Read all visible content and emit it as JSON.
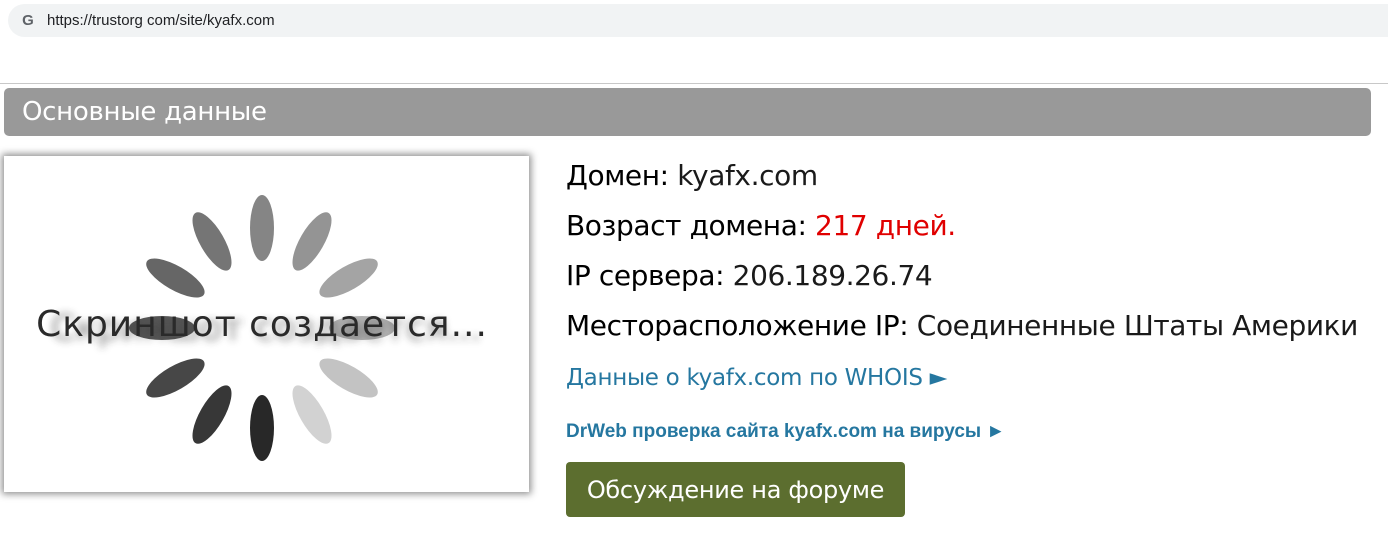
{
  "browser": {
    "url": "https://trustorg com/site/kyafx.com",
    "favicon": "google-g-icon"
  },
  "section": {
    "title": "Основные данные"
  },
  "screenshot": {
    "placeholder_text": "Скриншот создается..."
  },
  "info": {
    "domain_label": "Домен:",
    "domain_value": "kyafx.com",
    "age_label": "Возраст домена:",
    "age_value": "217 дней.",
    "ip_label": "IP сервера:",
    "ip_value": "206.189.26.74",
    "location_label": "Месторасположение IP:",
    "location_value": "Соединенные Штаты Америки"
  },
  "links": {
    "whois": "Данные о kyafx.com по WHOIS ►",
    "drweb": "DrWeb проверка сайта kyafx.com на вирусы ►"
  },
  "forum_button": "Обсуждение на форуме",
  "colors": {
    "header_bg": "#999999",
    "link": "#2577a0",
    "age_value": "#e00000",
    "forum_button_bg": "#5c6e2f"
  }
}
